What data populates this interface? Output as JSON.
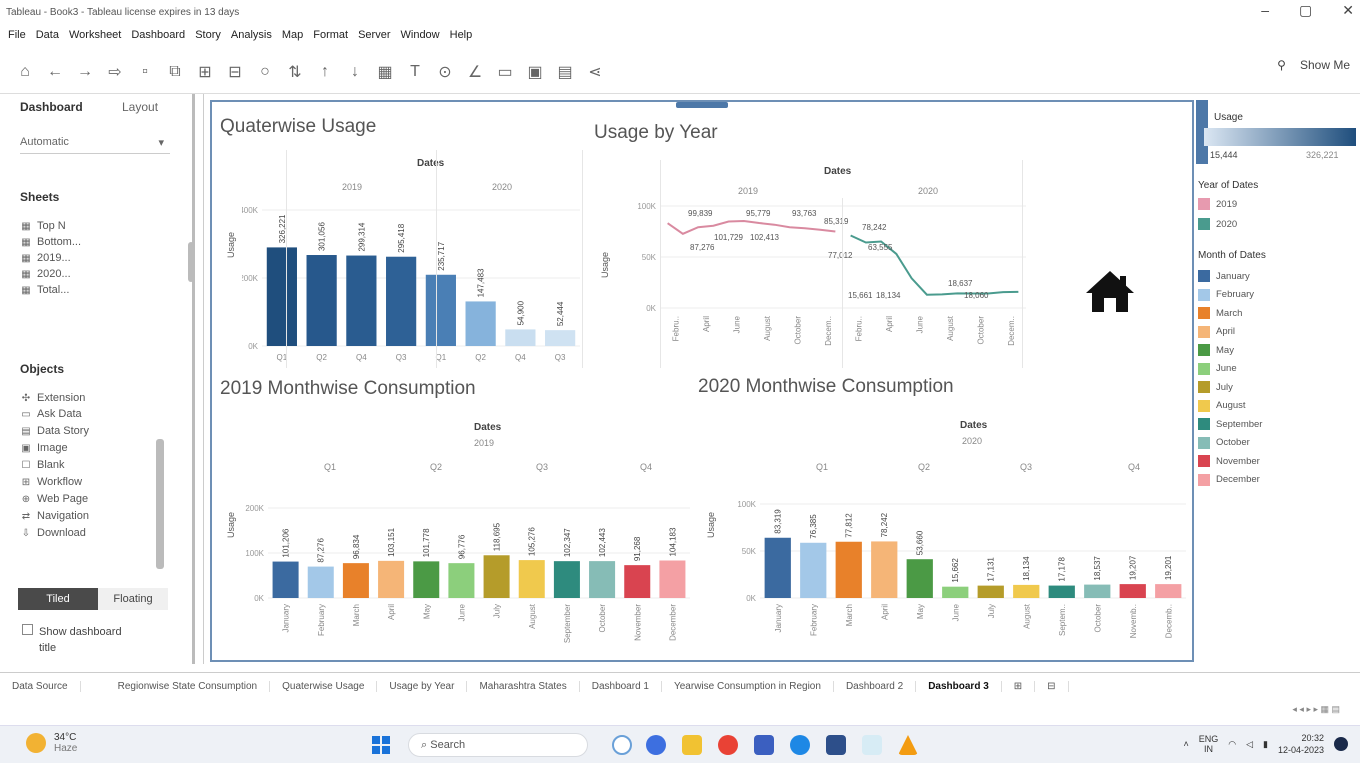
{
  "window": {
    "title": "Tableau - Book3 - Tableau license expires in 13 days"
  },
  "menu": [
    "File",
    "Data",
    "Worksheet",
    "Dashboard",
    "Story",
    "Analysis",
    "Map",
    "Format",
    "Server",
    "Window",
    "Help"
  ],
  "toolbar": {
    "show_me": "Show Me"
  },
  "left_panel": {
    "tab_dashboard": "Dashboard",
    "tab_layout": "Layout",
    "size": "Automatic",
    "sheets_title": "Sheets",
    "sheets": [
      "Top N",
      "Bottom...",
      "2019...",
      "2020...",
      "Total..."
    ],
    "objects_title": "Objects",
    "objects": [
      "Extension",
      "Ask Data",
      "Data Story",
      "Image",
      "Blank",
      "Workflow",
      "Web Page",
      "Navigation",
      "Download"
    ],
    "tiled": "Tiled",
    "floating": "Floating",
    "show_title_line1": "Show dashboard",
    "show_title_line2": "title"
  },
  "charts": {
    "quarter": {
      "title": "Quaterwise Usage",
      "dates": "Dates",
      "y19": "2019",
      "y20": "2020",
      "ylabel": "Usage",
      "ticks": [
        "400K",
        "200K",
        "0K"
      ]
    },
    "year": {
      "title": "Usage by Year",
      "dates": "Dates",
      "y19": "2019",
      "y20": "2020",
      "ylabel": "Usage",
      "ticks": [
        "100K",
        "50K",
        "0K"
      ]
    },
    "m2019": {
      "title": "2019 Monthwise Consumption",
      "dates": "Dates",
      "year": "2019",
      "ylabel": "Usage",
      "quarters": [
        "Q1",
        "Q2",
        "Q3",
        "Q4"
      ],
      "ticks": [
        "200K",
        "100K",
        "0K"
      ]
    },
    "m2020": {
      "title": "2020 Monthwise Consumption",
      "dates": "Dates",
      "year": "2020",
      "ylabel": "Usage",
      "quarters": [
        "Q1",
        "Q2",
        "Q3",
        "Q4"
      ],
      "ticks": [
        "100K",
        "50K",
        "0K"
      ]
    }
  },
  "chart_data": [
    {
      "type": "bar",
      "title": "Quaterwise Usage",
      "ylabel": "Usage",
      "categories": [
        "Q1 2019",
        "Q2 2019",
        "Q4 2019",
        "Q3 2019",
        "Q1 2020",
        "Q2 2020",
        "Q4 2020",
        "Q3 2020"
      ],
      "x_labels": [
        "Q1",
        "Q2",
        "Q4",
        "Q3",
        "Q1",
        "Q2",
        "Q4",
        "Q3"
      ],
      "values": [
        326221,
        301056,
        299314,
        295418,
        235717,
        147483,
        54900,
        52444
      ],
      "value_labels": [
        "326,221",
        "301,056",
        "299,314",
        "295,418",
        "235,717",
        "147,483",
        "54,900",
        "52,444"
      ],
      "colors": [
        "#1f4e7d",
        "#27588c",
        "#2a5c90",
        "#2e6196",
        "#4a7fb5",
        "#86b3dc",
        "#c9def0",
        "#cfe2f2"
      ],
      "ylim": [
        0,
        450000
      ]
    },
    {
      "type": "line",
      "title": "Usage by Year",
      "ylabel": "Usage",
      "series": [
        {
          "name": "2019",
          "color": "#d98aa0",
          "x": [
            "January",
            "February",
            "March",
            "April",
            "May",
            "June",
            "July",
            "August",
            "September",
            "October",
            "November",
            "December"
          ],
          "values": [
            99839,
            87276,
            95000,
            96779,
            101729,
            102413,
            100000,
            98000,
            95000,
            93763,
            92000,
            90000
          ]
        },
        {
          "name": "2020",
          "color": "#4a9b8e",
          "x": [
            "January",
            "February",
            "March",
            "April",
            "May",
            "June",
            "July",
            "August",
            "September",
            "October",
            "November",
            "December"
          ],
          "values": [
            85319,
            77012,
            78242,
            63556,
            35000,
            15661,
            16000,
            17134,
            17000,
            17000,
            18637,
            19000
          ]
        }
      ],
      "data_labels": [
        "99,839",
        "87,276",
        "95,779",
        "101,729",
        "102,413",
        "93,763",
        "85,319",
        "77,012",
        "78,242",
        "63,555",
        "15,661",
        "18,134",
        "18,637",
        "18,060"
      ],
      "x_labels": [
        "Febru..",
        "April",
        "June",
        "August",
        "October",
        "Decem..",
        "Febru..",
        "April",
        "June",
        "August",
        "October",
        "Decem.."
      ],
      "ylim": [
        0,
        120000
      ]
    },
    {
      "type": "bar",
      "title": "2019 Monthwise Consumption",
      "ylabel": "Usage",
      "categories": [
        "January",
        "February",
        "March",
        "April",
        "May",
        "June",
        "July",
        "August",
        "September",
        "October",
        "November",
        "December"
      ],
      "values": [
        101206,
        87276,
        96834,
        103151,
        101778,
        96776,
        118695,
        105276,
        102347,
        102443,
        91268,
        104183
      ],
      "value_labels": [
        "101,206",
        "87,276",
        "96,834",
        "103,151",
        "101,778",
        "96,776",
        "118,695",
        "105,276",
        "102,347",
        "102,443",
        "91,268",
        "104,183"
      ],
      "ylim": [
        0,
        250000
      ]
    },
    {
      "type": "bar",
      "title": "2020 Monthwise Consumption",
      "ylabel": "Usage",
      "categories": [
        "January",
        "February",
        "March",
        "April",
        "May",
        "June",
        "July",
        "August",
        "September",
        "October",
        "November",
        "December"
      ],
      "values": [
        83319,
        76385,
        77812,
        78242,
        53660,
        15662,
        17131,
        18134,
        17178,
        18537,
        19207,
        19201
      ],
      "value_labels": [
        "83,319",
        "76,385",
        "77,812",
        "78,242",
        "53,660",
        "15,662",
        "17,131",
        "18,134",
        "17,178",
        "18,537",
        "19,207",
        "19,201"
      ],
      "x_labels": [
        "January",
        "February",
        "March",
        "April",
        "May",
        "June",
        "July",
        "August",
        "Septem..",
        "October",
        "Novemb..",
        "Decemb.."
      ],
      "ylim": [
        0,
        130000
      ]
    }
  ],
  "legend": {
    "usage_title": "Usage",
    "usage_min": "15,444",
    "usage_max": "326,221",
    "year_title": "Year of Dates",
    "years": [
      {
        "label": "2019",
        "color": "#e79aaf"
      },
      {
        "label": "2020",
        "color": "#4a9b8e"
      }
    ],
    "month_title": "Month of Dates",
    "months": [
      {
        "label": "January",
        "color": "#3b6aa0"
      },
      {
        "label": "February",
        "color": "#a3c8e8"
      },
      {
        "label": "March",
        "color": "#e8812a"
      },
      {
        "label": "April",
        "color": "#f5b577"
      },
      {
        "label": "May",
        "color": "#4b9a45"
      },
      {
        "label": "June",
        "color": "#8ccf7c"
      },
      {
        "label": "July",
        "color": "#b59c2a"
      },
      {
        "label": "August",
        "color": "#f0c94d"
      },
      {
        "label": "September",
        "color": "#2e8b7e"
      },
      {
        "label": "October",
        "color": "#86bcb6"
      },
      {
        "label": "November",
        "color": "#d94450"
      },
      {
        "label": "December",
        "color": "#f4a0a4"
      }
    ]
  },
  "sheet_tabs": [
    "Data Source",
    "",
    "Regionwise State Consumption",
    "Quaterwise Usage",
    "Usage by Year",
    "Maharashtra States",
    "Dashboard 1",
    "Yearwise Consumption in Region",
    "Dashboard 2",
    "Dashboard 3"
  ],
  "taskbar": {
    "temp": "34°C",
    "weather": "Haze",
    "search": "Search",
    "lang1": "ENG",
    "lang2": "IN",
    "time": "20:32",
    "date": "12-04-2023"
  }
}
